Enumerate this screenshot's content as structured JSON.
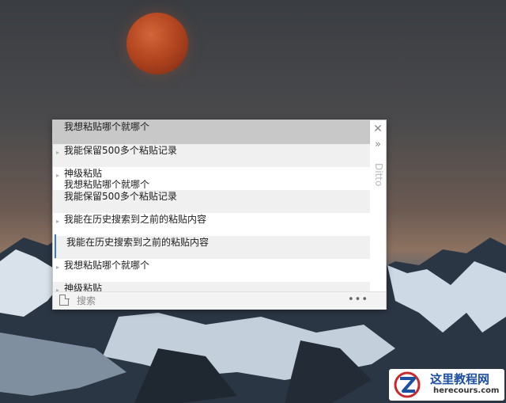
{
  "clipboard_list": {
    "items": [
      {
        "lines": [
          "我想粘贴哪个就哪个"
        ],
        "state": "selected"
      },
      {
        "lines": [
          "我能保留500多个粘贴记录"
        ],
        "state": "alt"
      },
      {
        "lines": [
          "神级粘贴",
          "我想粘贴哪个就哪个"
        ],
        "state": "normal"
      },
      {
        "lines": [
          "我能保留500多个粘贴记录"
        ],
        "state": "alt"
      },
      {
        "lines": [
          "我能在历史搜索到之前的粘贴内容"
        ],
        "state": "normal"
      },
      {
        "lines": [
          "我能在历史搜索到之前的粘贴内容"
        ],
        "state": "alt-focused"
      },
      {
        "lines": [
          "我想粘贴哪个就哪个"
        ],
        "state": "normal"
      },
      {
        "lines": [
          "神级粘贴"
        ],
        "state": "alt"
      }
    ]
  },
  "side_panel": {
    "close_glyph": "✕",
    "expand_glyph": "»",
    "brand_label": "Ditto"
  },
  "bottom_bar": {
    "search_placeholder": "搜索",
    "search_value": "",
    "more_glyph": "•••"
  },
  "watermark": {
    "title": "这里教程网",
    "url": "herecours.com"
  },
  "colors": {
    "selected_row": "#c8c8c8",
    "alt_row": "#f0f0f0",
    "focus_bar": "#3a7bd5"
  }
}
